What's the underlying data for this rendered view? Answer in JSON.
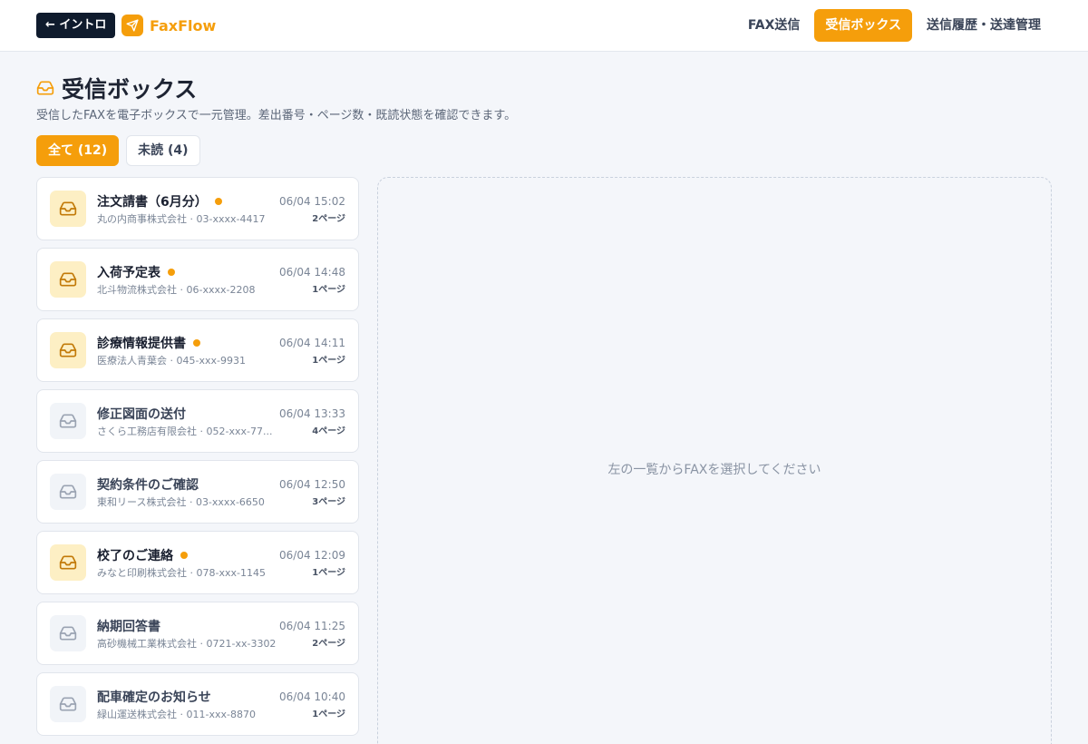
{
  "header": {
    "intro_label": "← イントロ",
    "app_name": "FaxFlow",
    "logo_icon": "paper-plane-icon",
    "nav": [
      {
        "label": "FAX送信",
        "active": false
      },
      {
        "label": "受信ボックス",
        "active": true
      },
      {
        "label": "送信履歴・送達管理",
        "active": false
      }
    ]
  },
  "page": {
    "title_icon": "inbox-icon",
    "title": "受信ボックス",
    "subtitle": "受信したFAXを電子ボックスで一元管理。差出番号・ページ数・既読状態を確認できます。"
  },
  "filters": {
    "all_label": "全て (12)",
    "unread_label": "未読 (4)"
  },
  "inbox": [
    {
      "title": "注文請書（6月分）",
      "meta": "丸の内商事株式会社 · 03-xxxx-4417",
      "time": "06/04 15:02",
      "pages": "2ページ",
      "unread": true
    },
    {
      "title": "入荷予定表",
      "meta": "北斗物流株式会社 · 06-xxxx-2208",
      "time": "06/04 14:48",
      "pages": "1ページ",
      "unread": true
    },
    {
      "title": "診療情報提供書",
      "meta": "医療法人青葉会 · 045-xxx-9931",
      "time": "06/04 14:11",
      "pages": "1ページ",
      "unread": true
    },
    {
      "title": "修正図面の送付",
      "meta": "さくら工務店有限会社 · 052-xxx-77...",
      "time": "06/04 13:33",
      "pages": "4ページ",
      "unread": false
    },
    {
      "title": "契約条件のご確認",
      "meta": "東和リース株式会社 · 03-xxxx-6650",
      "time": "06/04 12:50",
      "pages": "3ページ",
      "unread": false
    },
    {
      "title": "校了のご連絡",
      "meta": "みなと印刷株式会社 · 078-xxx-1145",
      "time": "06/04 12:09",
      "pages": "1ページ",
      "unread": true
    },
    {
      "title": "納期回答書",
      "meta": "高砂機械工業株式会社 · 0721-xx-3302",
      "time": "06/04 11:25",
      "pages": "2ページ",
      "unread": false
    },
    {
      "title": "配車確定のお知らせ",
      "meta": "緑山運送株式会社 · 011-xxx-8870",
      "time": "06/04 10:40",
      "pages": "1ページ",
      "unread": false
    }
  ],
  "detail": {
    "empty_message": "左の一覧からFAXを選択してください"
  },
  "colors": {
    "accent": "#f59e0b",
    "dark": "#0f1b2d",
    "unread_icon_bg": "#fdefc4",
    "read_icon_bg": "#f1f4f8"
  }
}
